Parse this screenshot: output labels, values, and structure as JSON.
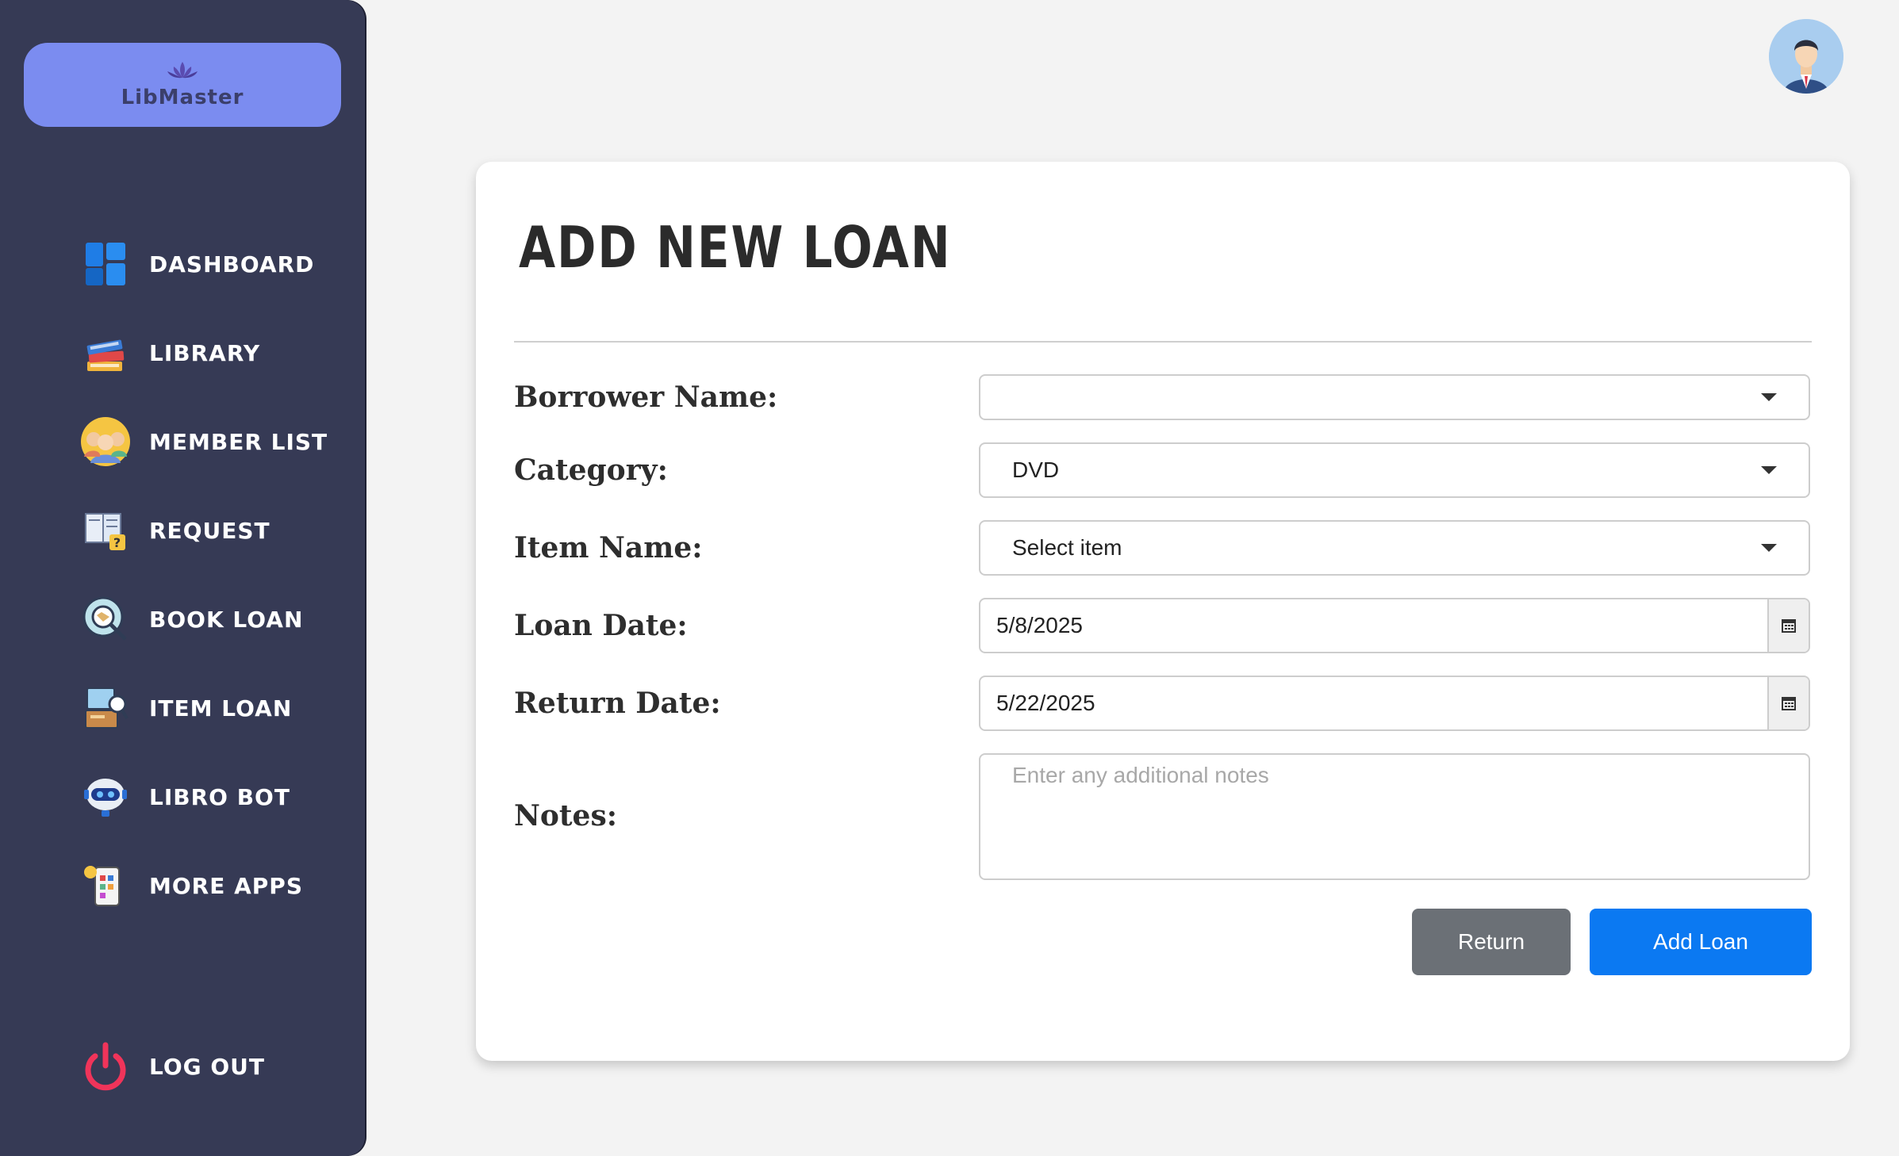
{
  "app": {
    "name": "LibMaster"
  },
  "sidebar": {
    "items": [
      {
        "label": "DASHBOARD",
        "icon": "dashboard-icon"
      },
      {
        "label": "LIBRARY",
        "icon": "books-icon"
      },
      {
        "label": "MEMBER LIST",
        "icon": "members-icon"
      },
      {
        "label": "REQUEST",
        "icon": "request-icon"
      },
      {
        "label": "BOOK LOAN",
        "icon": "book-loan-icon"
      },
      {
        "label": "ITEM LOAN",
        "icon": "item-loan-icon"
      },
      {
        "label": "LIBRO BOT",
        "icon": "robot-icon"
      },
      {
        "label": "MORE APPS",
        "icon": "apps-icon"
      }
    ],
    "logout": {
      "label": "LOG OUT",
      "icon": "power-icon"
    }
  },
  "form": {
    "title": "ADD NEW LOAN",
    "borrower": {
      "label": "Borrower Name:",
      "value": ""
    },
    "category": {
      "label": "Category:",
      "value": "DVD"
    },
    "item": {
      "label": "Item Name:",
      "value": "Select item"
    },
    "loan_date": {
      "label": "Loan Date:",
      "value": "5/8/2025"
    },
    "return_date": {
      "label": "Return Date:",
      "value": "5/22/2025"
    },
    "notes": {
      "label": "Notes:",
      "placeholder": "Enter any additional notes"
    },
    "buttons": {
      "return": "Return",
      "add": "Add Loan"
    }
  },
  "colors": {
    "sidebar": "#363a55",
    "logo_bg": "#7b8cf0",
    "primary": "#0b79f2",
    "secondary": "#6b7076"
  }
}
